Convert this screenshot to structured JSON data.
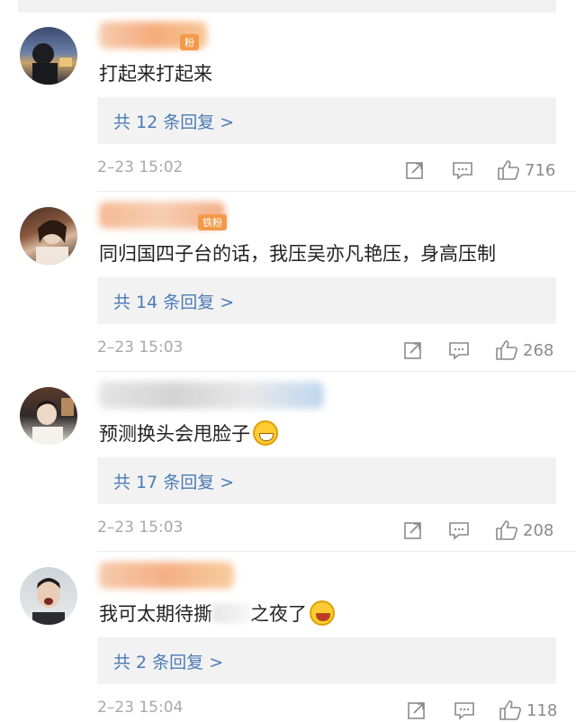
{
  "comments": [
    {
      "badge": "粉",
      "text": "打起来打起来",
      "emoji": "",
      "replies": "共 12 条回复 >",
      "time": "2–23 15:02",
      "likes": "716"
    },
    {
      "badge": "铁粉",
      "text": "同归国四子台的话，我压吴亦凡艳压，身高压制",
      "emoji": "",
      "replies": "共 14 条回复 >",
      "time": "2–23 15:03",
      "likes": "268"
    },
    {
      "badge": "",
      "text": "预测换头会甩脸子",
      "emoji": "grin",
      "replies": "共 17 条回复 >",
      "time": "2–23 15:03",
      "likes": "208"
    },
    {
      "badge": "",
      "text": "我可太期待撕",
      "text_after": "之夜了",
      "emoji": "laugh",
      "replies": "共 2 条回复 >",
      "time": "2–23 15:04",
      "likes": "118"
    }
  ],
  "colors": {
    "link": "#4a7bb7",
    "meta": "#a8a8a8",
    "box": "#f2f2f2"
  },
  "icons": [
    "share-icon",
    "comment-icon",
    "like-icon"
  ]
}
